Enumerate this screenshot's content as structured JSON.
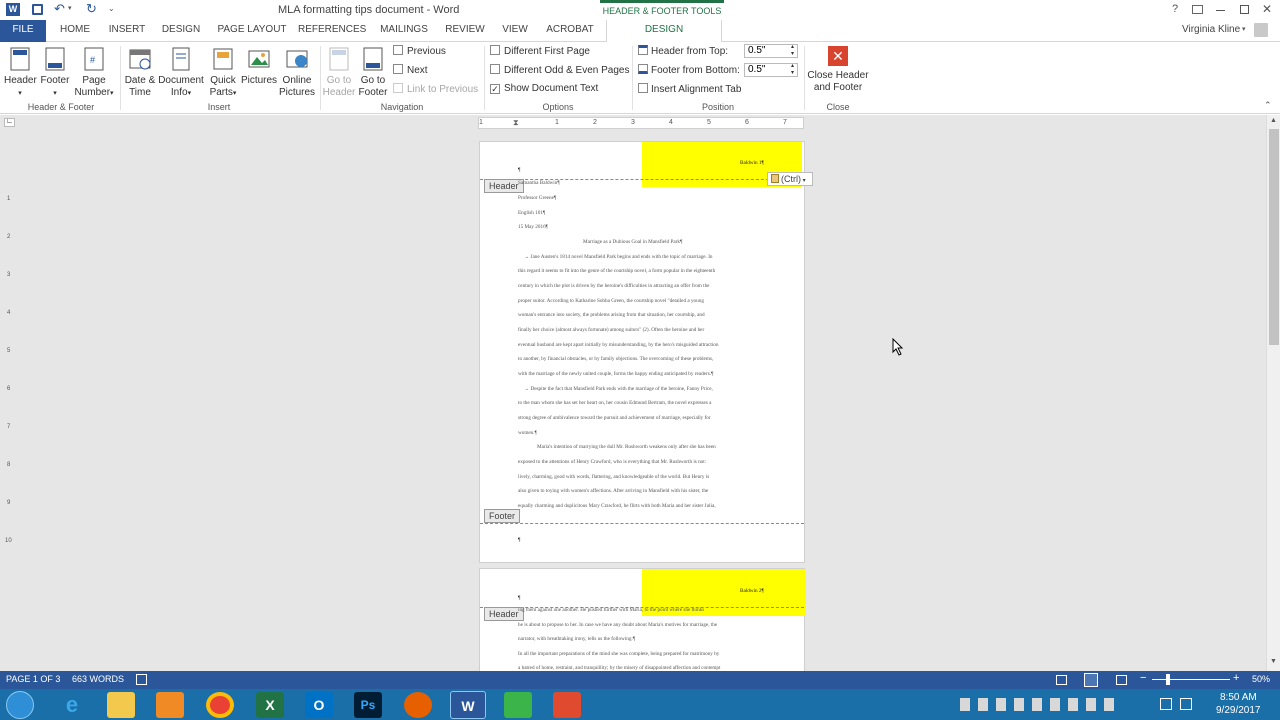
{
  "window": {
    "title": "MLA formatting tips document - Word",
    "context_tab_group": "HEADER & FOOTER TOOLS",
    "user": "Virginia Kline",
    "help": "?"
  },
  "tabs": [
    {
      "label": "FILE"
    },
    {
      "label": "HOME"
    },
    {
      "label": "INSERT"
    },
    {
      "label": "DESIGN"
    },
    {
      "label": "PAGE LAYOUT"
    },
    {
      "label": "REFERENCES"
    },
    {
      "label": "MAILINGS"
    },
    {
      "label": "REVIEW"
    },
    {
      "label": "VIEW"
    },
    {
      "label": "ACROBAT"
    },
    {
      "label": "DESIGN"
    }
  ],
  "ribbon": {
    "header_footer": {
      "header": "Header",
      "footer": "Footer",
      "page_number_1": "Page",
      "page_number_2": "Number",
      "group": "Header & Footer"
    },
    "insert": {
      "date_1": "Date &",
      "date_2": "Time",
      "docinfo_1": "Document",
      "docinfo_2": "Info",
      "quick_1": "Quick",
      "quick_2": "Parts",
      "pictures": "Pictures",
      "online_1": "Online",
      "online_2": "Pictures",
      "group": "Insert"
    },
    "navigation": {
      "goto_header_1": "Go to",
      "goto_header_2": "Header",
      "goto_footer_1": "Go to",
      "goto_footer_2": "Footer",
      "previous": "Previous",
      "next": "Next",
      "link_previous": "Link to Previous",
      "group": "Navigation"
    },
    "options": {
      "diff_first": "Different First Page",
      "diff_odd_even": "Different Odd & Even Pages",
      "show_doc_text": "Show Document Text",
      "show_doc_text_checked": true,
      "group": "Options"
    },
    "position": {
      "header_from_top": "Header from Top:",
      "header_from_top_value": "0.5\"",
      "footer_from_bottom": "Footer from Bottom:",
      "footer_from_bottom_value": "0.5\"",
      "insert_alignment_tab": "Insert Alignment Tab",
      "group": "Position"
    },
    "close": {
      "close_1": "Close Header",
      "close_2": "and Footer",
      "group": "Close"
    }
  },
  "ruler": {
    "numbers": [
      "1",
      "1",
      "2",
      "3",
      "4",
      "5",
      "6",
      "7"
    ]
  },
  "vruler_numbers": [
    "1",
    "2",
    "3",
    "4",
    "5",
    "6",
    "7",
    "8",
    "9",
    "10"
  ],
  "document": {
    "page1": {
      "header_label": "Header",
      "footer_label": "Footer",
      "header_text": "Baldwin 1¶",
      "paste_ctrl": "(Ctrl)",
      "pilcrow": "¶",
      "lines": [
        "Samantha Baldwin¶",
        "Professor Greene¶",
        "English 101¶",
        "15 May 2016¶",
        "Marriage as a Dubious Goal in Mansfield Park¶",
        "→ Jane Austen's 1814 novel Mansfield Park begins and ends with the topic of marriage. In",
        "this regard it seems to fit into the genre of the courtship novel, a form popular in the eighteenth",
        "century in which the plot is driven by the heroine's difficulties in attracting an offer from the",
        "proper suitor. According to Katharine Sobba Green, the courtship novel \"detailed a young",
        "woman's entrance into society, the problems arising from that situation, her courtship, and",
        "finally her choice (almost always fortunate) among suitors\" (2). Often the heroine and her",
        "eventual husband are kept apart initially by misunderstanding, by the hero's misguided attraction",
        "to another, by financial obstacles, or by family objections. The overcoming of these problems,",
        "with the marriage of the newly united couple, forms the happy ending anticipated by readers.¶",
        "→ Despite the fact that Mansfield Park ends with the marriage of the heroine, Fanny Price,",
        "to the man whom she has set her heart on, her cousin Edmund Bertram, the novel expresses a",
        "strong degree of ambivalence toward the pursuit and achievement of marriage, especially for",
        "women.¶",
        "Maria's intention of marrying the dull Mr. Rushworth weakens only after she has been",
        "exposed to the attentions of Henry Crawford, who is everything that Mr. Rushworth is not:",
        "lively, charming, good with words, flattering, and knowledgeable of the world. But Henry is",
        "also given to toying with women's affections. After arriving in Mansfield with his sister, the",
        "equally charming and duplicitous Mary Crawford, he flirts with both Maria and her sister Julia,"
      ]
    },
    "page2": {
      "header_label": "Header",
      "header_text": "Baldwin 2¶",
      "pilcrow": "¶",
      "lines": [
        "ing them against one another. He pushed further with Maria, to the point where she thinks",
        "he is about to propose to her. In case we have any doubt about Maria's motives for marriage, the",
        "narrator, with breathtaking irony, tells us the following:¶",
        "In all the important preparations of the mind she was complete, being prepared for matrimony by",
        "a hatred of home, restraint, and tranquillity; by the misery of disappointed affection and contempt"
      ]
    }
  },
  "status": {
    "page": "PAGE 1 OF 3",
    "words": "663 WORDS",
    "zoom": "50%"
  },
  "tray": {
    "time": "8:50 AM",
    "date": "9/29/2017"
  },
  "colors": {
    "word_blue": "#2b579a",
    "context_green": "#217346",
    "highlight": "#ffff00",
    "taskbar": "#1b6fa8"
  }
}
